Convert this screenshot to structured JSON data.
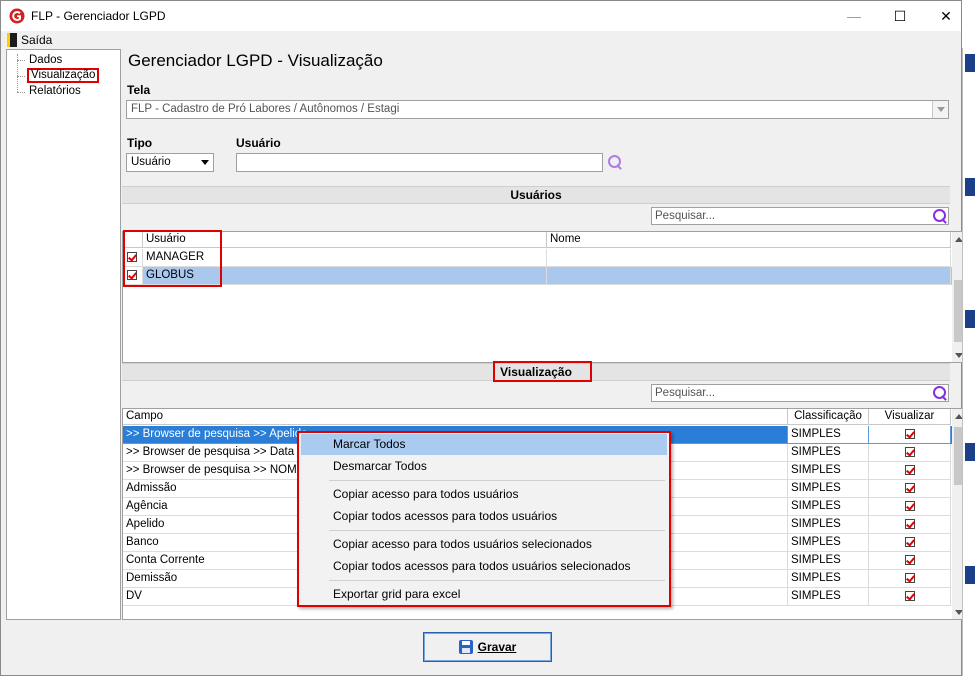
{
  "window": {
    "title": "FLP - Gerenciador LGPD",
    "minimize_glyph": "—",
    "maximize_glyph": "☐",
    "close_glyph": "✕"
  },
  "menu": {
    "exit_label": "Saída"
  },
  "tree": {
    "items": [
      {
        "label": "Dados"
      },
      {
        "label": "Visualização"
      },
      {
        "label": "Relatórios"
      }
    ]
  },
  "main": {
    "title": "Gerenciador LGPD - Visualização",
    "tela_label": "Tela",
    "tela_value": "FLP - Cadastro de Pró Labores / Autônomos / Estagi",
    "tipo_label": "Tipo",
    "tipo_value": "Usuário",
    "usuario_label": "Usuário",
    "usuario_value": ""
  },
  "usuarios_section": {
    "title": "Usuários",
    "search_placeholder": "Pesquisar...",
    "columns": [
      "Usuário",
      "Nome"
    ],
    "rows": [
      {
        "usuario": "MANAGER",
        "nome": ""
      },
      {
        "usuario": "GLOBUS",
        "nome": ""
      }
    ]
  },
  "visualizacao_section": {
    "title": "Visualização",
    "search_placeholder": "Pesquisar...",
    "columns": [
      "Campo",
      "Classificação",
      "Visualizar"
    ],
    "rows": [
      {
        "campo": ">> Browser de pesquisa >> Apelido",
        "classificacao": "SIMPLES"
      },
      {
        "campo": ">> Browser de pesquisa >> Data de",
        "classificacao": "SIMPLES"
      },
      {
        "campo": ">> Browser de pesquisa >> NOME",
        "classificacao": "SIMPLES"
      },
      {
        "campo": "Admissão",
        "classificacao": "SIMPLES"
      },
      {
        "campo": "Agência",
        "classificacao": "SIMPLES"
      },
      {
        "campo": "Apelido",
        "classificacao": "SIMPLES"
      },
      {
        "campo": "Banco",
        "classificacao": "SIMPLES"
      },
      {
        "campo": "Conta Corrente",
        "classificacao": "SIMPLES"
      },
      {
        "campo": "Demissão",
        "classificacao": "SIMPLES"
      },
      {
        "campo": "DV",
        "classificacao": "SIMPLES"
      }
    ]
  },
  "context_menu": {
    "items": [
      "Marcar Todos",
      "Desmarcar Todos",
      "Copiar acesso para todos usuários",
      "Copiar todos acessos para todos usuários",
      "Copiar acesso para todos usuários selecionados",
      "Copiar todos acessos para todos usuários selecionados",
      "Exportar grid para excel"
    ]
  },
  "footer": {
    "save_label": "Gravar"
  },
  "colors": {
    "accent_red": "#e00000",
    "selection_blue": "#2a7ed8",
    "search_icon": "#8b2ce0"
  }
}
